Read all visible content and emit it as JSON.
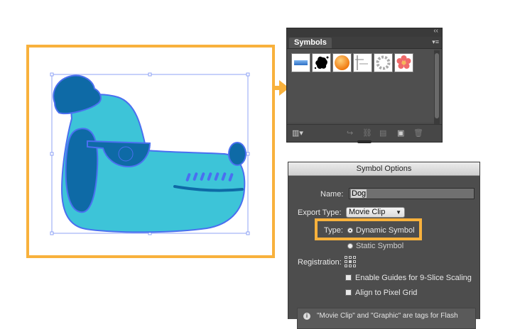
{
  "colors": {
    "highlight": "#f8b13c",
    "dog_body": "#3dc4d8",
    "dog_dark": "#0e6aa6",
    "selection_outline": "#4a6ff0"
  },
  "symbols_panel": {
    "tab_label": "Symbols",
    "collapse_icon": "double-chevron-icon",
    "menu_icon": "panel-menu-icon",
    "swatches": [
      {
        "name": "blue-bar-symbol"
      },
      {
        "name": "ink-splat-symbol"
      },
      {
        "name": "orange-ball-symbol"
      },
      {
        "name": "grunge-lines-symbol"
      },
      {
        "name": "ring-symbol"
      },
      {
        "name": "flower-symbol"
      }
    ],
    "tools": [
      "library-icon",
      "place-instance-icon",
      "break-link-icon",
      "symbol-options-icon",
      "new-symbol-icon",
      "delete-icon"
    ]
  },
  "dialog": {
    "title": "Symbol Options",
    "name_label": "Name:",
    "name_value": "Dog",
    "export_type_label": "Export Type:",
    "export_type_value": "Movie Clip",
    "type_label": "Type:",
    "type_options": [
      {
        "label": "Dynamic Symbol",
        "selected": true
      },
      {
        "label": "Static Symbol",
        "selected": false
      }
    ],
    "registration_label": "Registration:",
    "checkboxes": [
      {
        "label": "Enable Guides for 9-Slice Scaling",
        "checked": false
      },
      {
        "label": "Align to Pixel Grid",
        "checked": false
      }
    ],
    "info_text": "\"Movie Clip\" and \"Graphic\" are tags for Flash"
  }
}
